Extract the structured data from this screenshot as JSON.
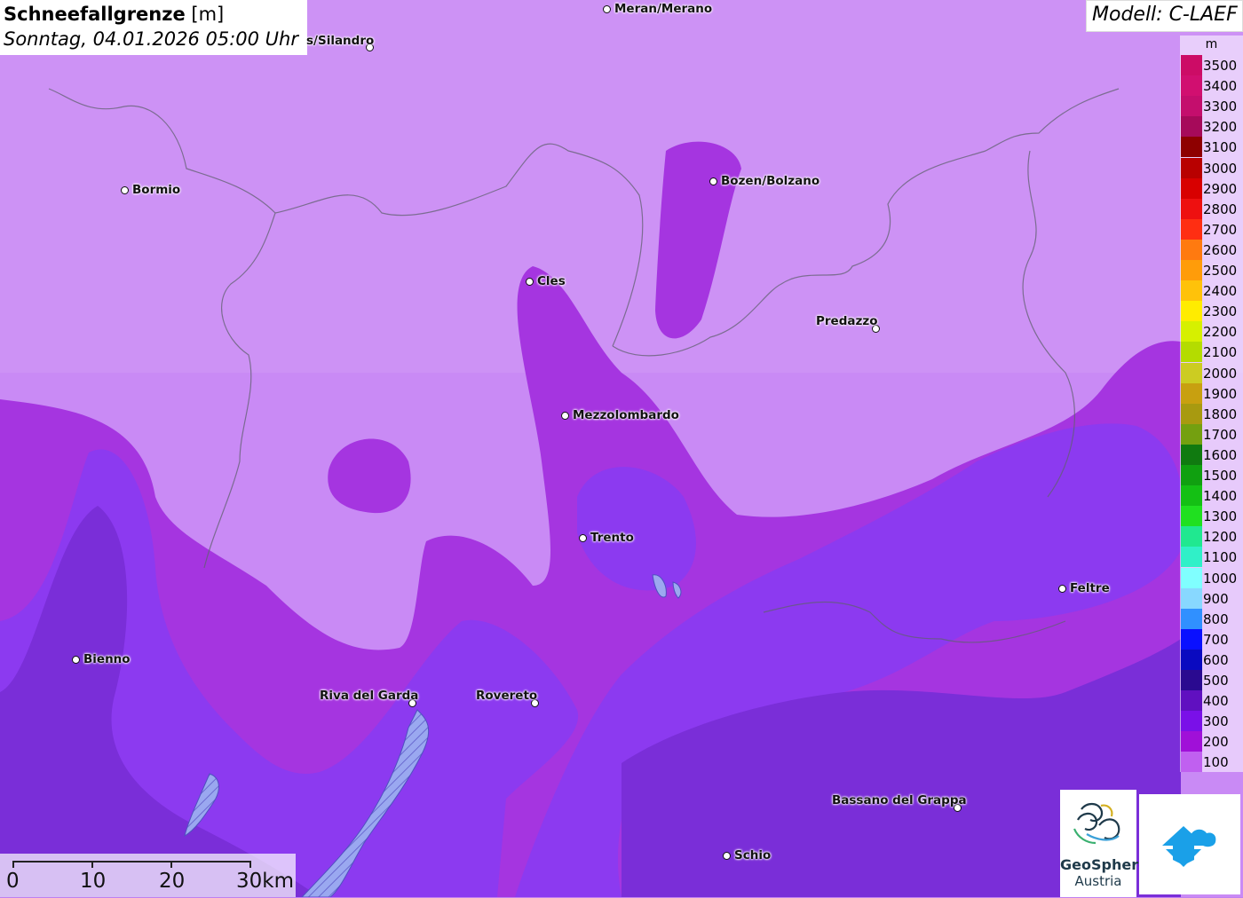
{
  "header": {
    "title_bold": "Schneefallgrenze",
    "title_unit": "[m]",
    "datetime": "Sonntag, 04.01.2026 05:00 Uhr"
  },
  "model": {
    "label": "Modell: C-LAEF"
  },
  "legend": {
    "unit": "m",
    "items": [
      {
        "label": "3500",
        "color": "#cc0c66"
      },
      {
        "label": "3400",
        "color": "#d10f70"
      },
      {
        "label": "3300",
        "color": "#c40e6d"
      },
      {
        "label": "3200",
        "color": "#a60a5a"
      },
      {
        "label": "3100",
        "color": "#8e0000"
      },
      {
        "label": "3000",
        "color": "#b80000"
      },
      {
        "label": "2900",
        "color": "#d80000"
      },
      {
        "label": "2800",
        "color": "#ee1010"
      },
      {
        "label": "2700",
        "color": "#ff2e12"
      },
      {
        "label": "2600",
        "color": "#ff7a10"
      },
      {
        "label": "2500",
        "color": "#ff9c0a"
      },
      {
        "label": "2400",
        "color": "#ffc20a"
      },
      {
        "label": "2300",
        "color": "#ffec00"
      },
      {
        "label": "2200",
        "color": "#d6f000"
      },
      {
        "label": "2100",
        "color": "#b4dc00"
      },
      {
        "label": "2000",
        "color": "#cccc22"
      },
      {
        "label": "1900",
        "color": "#c8a010"
      },
      {
        "label": "1800",
        "color": "#a89a10"
      },
      {
        "label": "1700",
        "color": "#74a010"
      },
      {
        "label": "1600",
        "color": "#107a10"
      },
      {
        "label": "1500",
        "color": "#10a010"
      },
      {
        "label": "1400",
        "color": "#14c014"
      },
      {
        "label": "1300",
        "color": "#20e020"
      },
      {
        "label": "1200",
        "color": "#20e890"
      },
      {
        "label": "1100",
        "color": "#30f0c8"
      },
      {
        "label": "1000",
        "color": "#80ffff"
      },
      {
        "label": "900",
        "color": "#88d8ff"
      },
      {
        "label": "800",
        "color": "#3090ff"
      },
      {
        "label": "700",
        "color": "#0a10ff"
      },
      {
        "label": "600",
        "color": "#0a0ac0"
      },
      {
        "label": "500",
        "color": "#2a0a90"
      },
      {
        "label": "400",
        "color": "#6010c0"
      },
      {
        "label": "300",
        "color": "#7a10e8"
      },
      {
        "label": "200",
        "color": "#a010d8"
      },
      {
        "label": "100",
        "color": "#c060f0"
      }
    ]
  },
  "cities": [
    {
      "name": "Meran/Merano"
    },
    {
      "name": "s/Silandro"
    },
    {
      "name": "Bormio"
    },
    {
      "name": "Bozen/Bolzano"
    },
    {
      "name": "Cles"
    },
    {
      "name": "Predazzo"
    },
    {
      "name": "Mezzolombardo"
    },
    {
      "name": "Trento"
    },
    {
      "name": "Feltre"
    },
    {
      "name": "Bienno"
    },
    {
      "name": "Riva del Garda"
    },
    {
      "name": "Rovereto"
    },
    {
      "name": "Bassano del Grappa"
    },
    {
      "name": "Schio"
    }
  ],
  "scalebar": {
    "labels": [
      "0",
      "10",
      "20",
      "30km"
    ]
  },
  "logos": {
    "geosphere_line1": "GeoSphere",
    "geosphere_line2": "Austria"
  },
  "colors": {
    "land_light": "#c98af5",
    "band_magenta": "#a535e0",
    "band_violet": "#8a30f0",
    "band_deep": "#7a2cd8",
    "lake": "#8f9ff0"
  }
}
